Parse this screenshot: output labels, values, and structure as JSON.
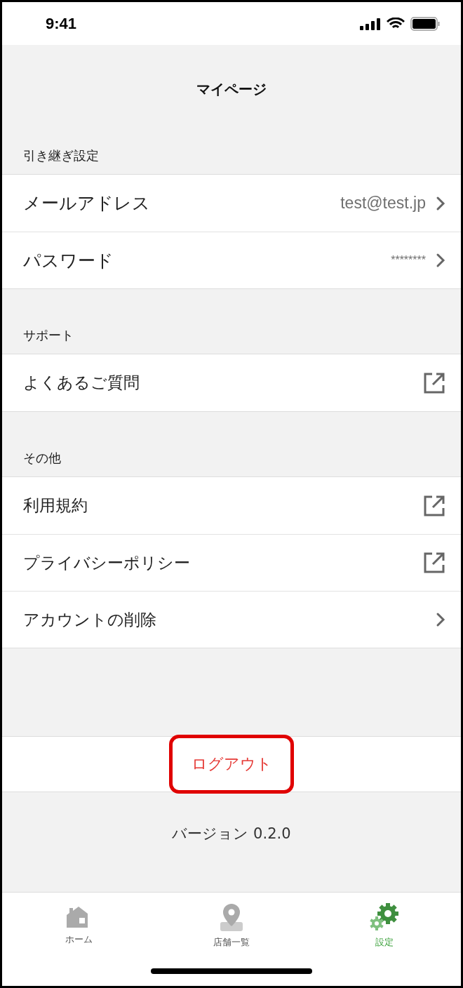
{
  "status_bar": {
    "time": "9:41"
  },
  "header": {
    "title": "マイページ"
  },
  "sections": [
    {
      "title": "引き継ぎ設定",
      "items": [
        {
          "label": "メールアドレス",
          "value": "test@test.jp",
          "kind": "chevron"
        },
        {
          "label": "パスワード",
          "value": "********",
          "kind": "chevron"
        }
      ]
    },
    {
      "title": "サポート",
      "items": [
        {
          "label": "よくあるご質問",
          "kind": "external"
        }
      ]
    },
    {
      "title": "その他",
      "items": [
        {
          "label": "利用規約",
          "kind": "external"
        },
        {
          "label": "プライバシーポリシー",
          "kind": "external"
        },
        {
          "label": "アカウントの削除",
          "kind": "chevron"
        }
      ]
    }
  ],
  "logout": {
    "label": "ログアウト",
    "highlighted": true
  },
  "version": "バージョン 0.2.0",
  "tab_bar": [
    {
      "label": "ホーム",
      "kind": "home",
      "selected": false
    },
    {
      "label": "店舗一覧",
      "kind": "pin",
      "selected": false
    },
    {
      "label": "設定",
      "kind": "gear",
      "selected": true
    }
  ]
}
